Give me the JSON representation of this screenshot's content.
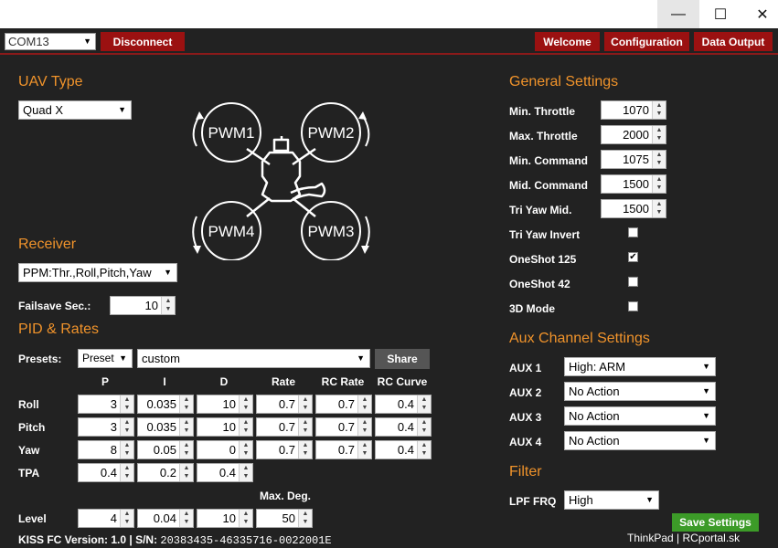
{
  "window": {
    "minimize": "—",
    "maximize": "☐",
    "close": "✕"
  },
  "toolbar": {
    "port": "COM13",
    "disconnect": "Disconnect",
    "welcome": "Welcome",
    "configuration": "Configuration",
    "data_output": "Data Output"
  },
  "uav": {
    "title": "UAV Type",
    "type": "Quad X",
    "motors": [
      "PWM1",
      "PWM2",
      "PWM3",
      "PWM4"
    ]
  },
  "receiver": {
    "title": "Receiver",
    "mode": "PPM:Thr.,Roll,Pitch,Yaw",
    "failsafe_label": "Failsave Sec.:",
    "failsafe_value": "10"
  },
  "pid": {
    "title": "PID & Rates",
    "presets_label": "Presets:",
    "preset": "Preset",
    "preset_name": "custom",
    "share": "Share",
    "columns": [
      "P",
      "I",
      "D",
      "Rate",
      "RC Rate",
      "RC Curve"
    ],
    "rows": [
      {
        "label": "Roll",
        "values": [
          "3",
          "0.035",
          "10",
          "0.7",
          "0.7",
          "0.4"
        ]
      },
      {
        "label": "Pitch",
        "values": [
          "3",
          "0.035",
          "10",
          "0.7",
          "0.7",
          "0.4"
        ]
      },
      {
        "label": "Yaw",
        "values": [
          "8",
          "0.05",
          "0",
          "0.7",
          "0.7",
          "0.4"
        ]
      }
    ],
    "tpa": {
      "label": "TPA",
      "values": [
        "0.4",
        "0.2",
        "0.4"
      ]
    },
    "max_deg_label": "Max. Deg.",
    "level": {
      "label": "Level",
      "values": [
        "4",
        "0.04",
        "10",
        "50"
      ]
    }
  },
  "general": {
    "title": "General Settings",
    "min_throttle": {
      "label": "Min. Throttle",
      "value": "1070"
    },
    "max_throttle": {
      "label": "Max. Throttle",
      "value": "2000"
    },
    "min_command": {
      "label": "Min. Command",
      "value": "1075"
    },
    "mid_command": {
      "label": "Mid. Command",
      "value": "1500"
    },
    "tri_yaw_mid": {
      "label": "Tri Yaw Mid.",
      "value": "1500"
    },
    "tri_yaw_invert": {
      "label": "Tri Yaw Invert",
      "checked": false
    },
    "oneshot125": {
      "label": "OneShot 125",
      "checked": true
    },
    "oneshot42": {
      "label": "OneShot 42",
      "checked": false
    },
    "mode3d": {
      "label": "3D Mode",
      "checked": false
    }
  },
  "aux": {
    "title": "Aux Channel Settings",
    "channels": [
      {
        "label": "AUX 1",
        "value": "High: ARM"
      },
      {
        "label": "AUX 2",
        "value": "No Action"
      },
      {
        "label": "AUX 3",
        "value": "No Action"
      },
      {
        "label": "AUX 4",
        "value": "No Action"
      }
    ]
  },
  "filter": {
    "title": "Filter",
    "lpf_label": "LPF FRQ",
    "lpf_value": "High"
  },
  "save": "Save Settings",
  "footer": {
    "version": "KISS FC Version: 1.0 | S/N:",
    "serial": "20383435-46335716-0022001E"
  },
  "watermark": "ThinkPad | RCportal.sk"
}
